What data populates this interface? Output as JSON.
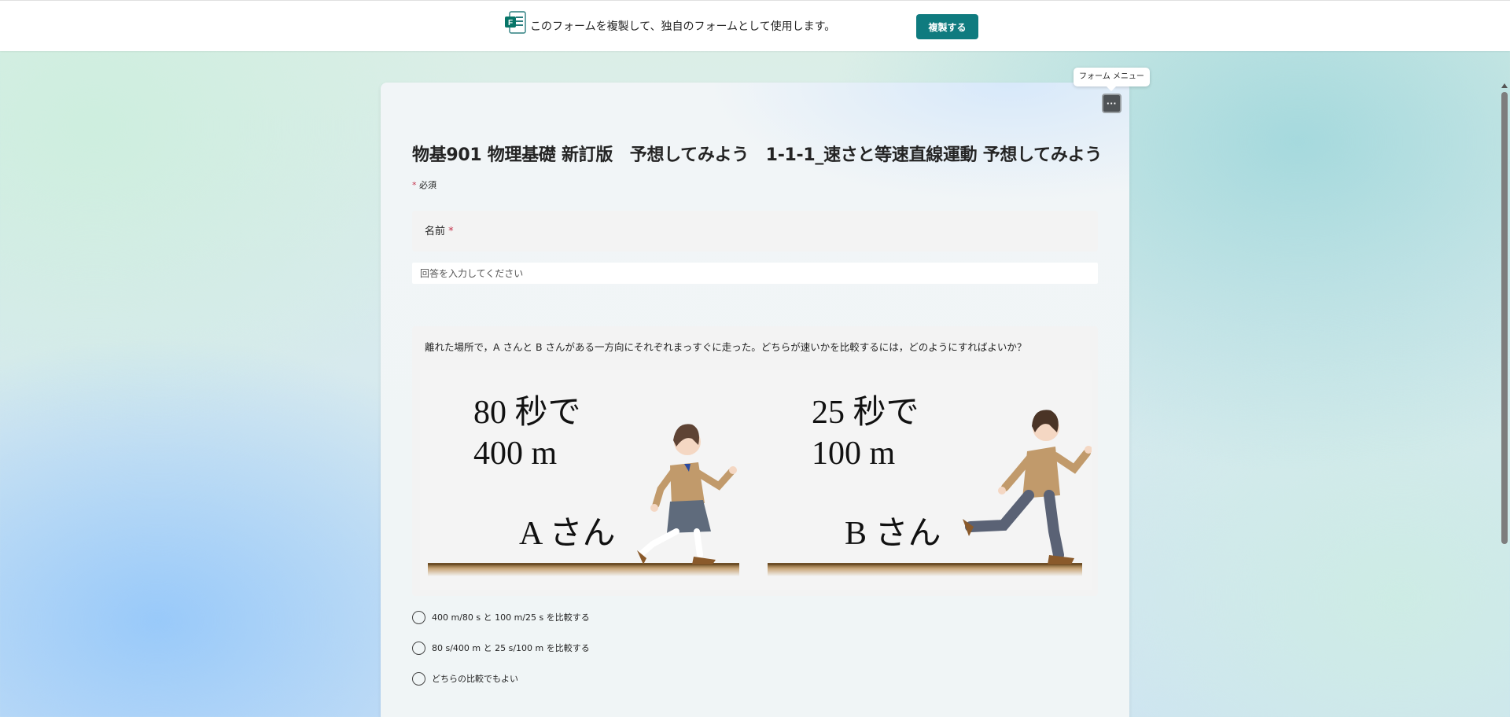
{
  "banner": {
    "icon": "forms-logo-icon",
    "text": "このフォームを複製して、独自のフォームとして使用します。",
    "copy_button": "複製する"
  },
  "menu": {
    "tooltip": "フォーム メニュー",
    "button_glyph": "···"
  },
  "form": {
    "title": "物基901 物理基礎 新訂版　予想してみよう　1-1-1_速さと等速直線運動 予想してみよう",
    "required_mark": "*",
    "required_text": " 必須",
    "q1": {
      "label": "名前",
      "required": "*",
      "placeholder": "回答を入力してください"
    },
    "q2": {
      "text": "離れた場所で，A さんと B さんがある一方向にそれぞれまっすぐに走った。どちらが速いかを比較するには，どのようにすればよいか？",
      "image": {
        "left_line1": "80 秒で",
        "left_line2": "400 m",
        "left_name": "A さん",
        "right_line1": "25 秒で",
        "right_line2": "100 m",
        "right_name": "B さん"
      },
      "choices": [
        "400 m/80 s と 100 m/25 s を比較する",
        "80 s/400 m と 25 s/100 m を比較する",
        "どちらの比較でもよい"
      ]
    }
  },
  "colors": {
    "accent": "#0f7b7f",
    "required": "#c4314b",
    "menu_button": "#4f5356"
  }
}
